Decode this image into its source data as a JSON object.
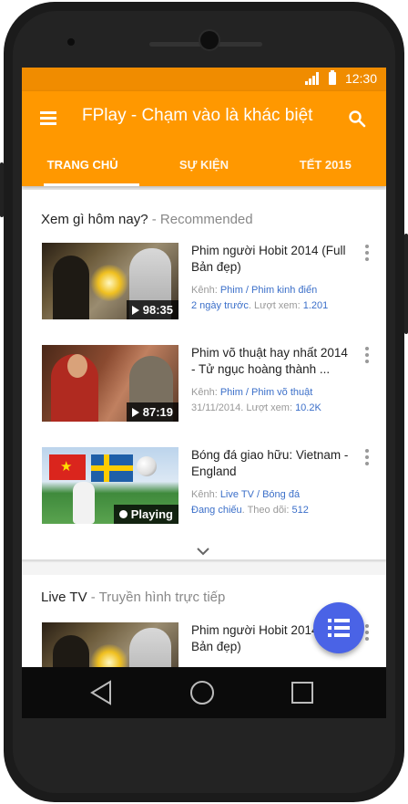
{
  "statusbar": {
    "time": "12:30",
    "signal_icon": "signal-icon",
    "battery_icon": "battery-icon"
  },
  "appbar": {
    "title": "FPlay - Chạm vào là khác biệt",
    "menu_icon": "menu-icon",
    "search_icon": "search-icon",
    "tabs": [
      {
        "label": "TRANG CHỦ",
        "active": true
      },
      {
        "label": "SỰ KIỆN",
        "active": false
      },
      {
        "label": "TẾT 2015",
        "active": false
      }
    ]
  },
  "recommended": {
    "title": "Xem gì hôm nay?",
    "subtitle": " - Recommended",
    "items": [
      {
        "title": "Phim người Hobit 2014 (Full Bản đẹp)",
        "meta_prefix": "Kênh: ",
        "channel": "Phim / Phim kinh điển",
        "line2_a": "2 ngày trước",
        "line2_b": ". Lượt xem: ",
        "line2_c": "1.201",
        "badge": "98:35"
      },
      {
        "title": "Phim võ thuật hay nhất 2014 - Tử ngục hoàng thành ...",
        "meta_prefix": "Kênh: ",
        "channel": "Phim / Phim võ thuật",
        "line2_a": "31/11/2014",
        "line2_b": ". Lượt xem: ",
        "line2_c": "10.2K",
        "badge": "87:19"
      },
      {
        "title": "Bóng đá giao hữu: Vietnam - England",
        "meta_prefix": "Kênh: ",
        "channel": "Live TV / Bóng đá",
        "line2_a": "Đang chiếu",
        "line2_b": ". Theo dõi: ",
        "line2_c": "512",
        "badge": "Playing"
      }
    ]
  },
  "livetv": {
    "title": "Live TV",
    "subtitle": " - Truyền hình trực tiếp",
    "items": [
      {
        "title": "Phim người Hobit 2014 (Full Bản đẹp)"
      }
    ]
  },
  "colors": {
    "primary": "#ff9800",
    "statusbar": "#f08c00",
    "link": "#3b6fc9",
    "fab": "#4a63e6"
  }
}
